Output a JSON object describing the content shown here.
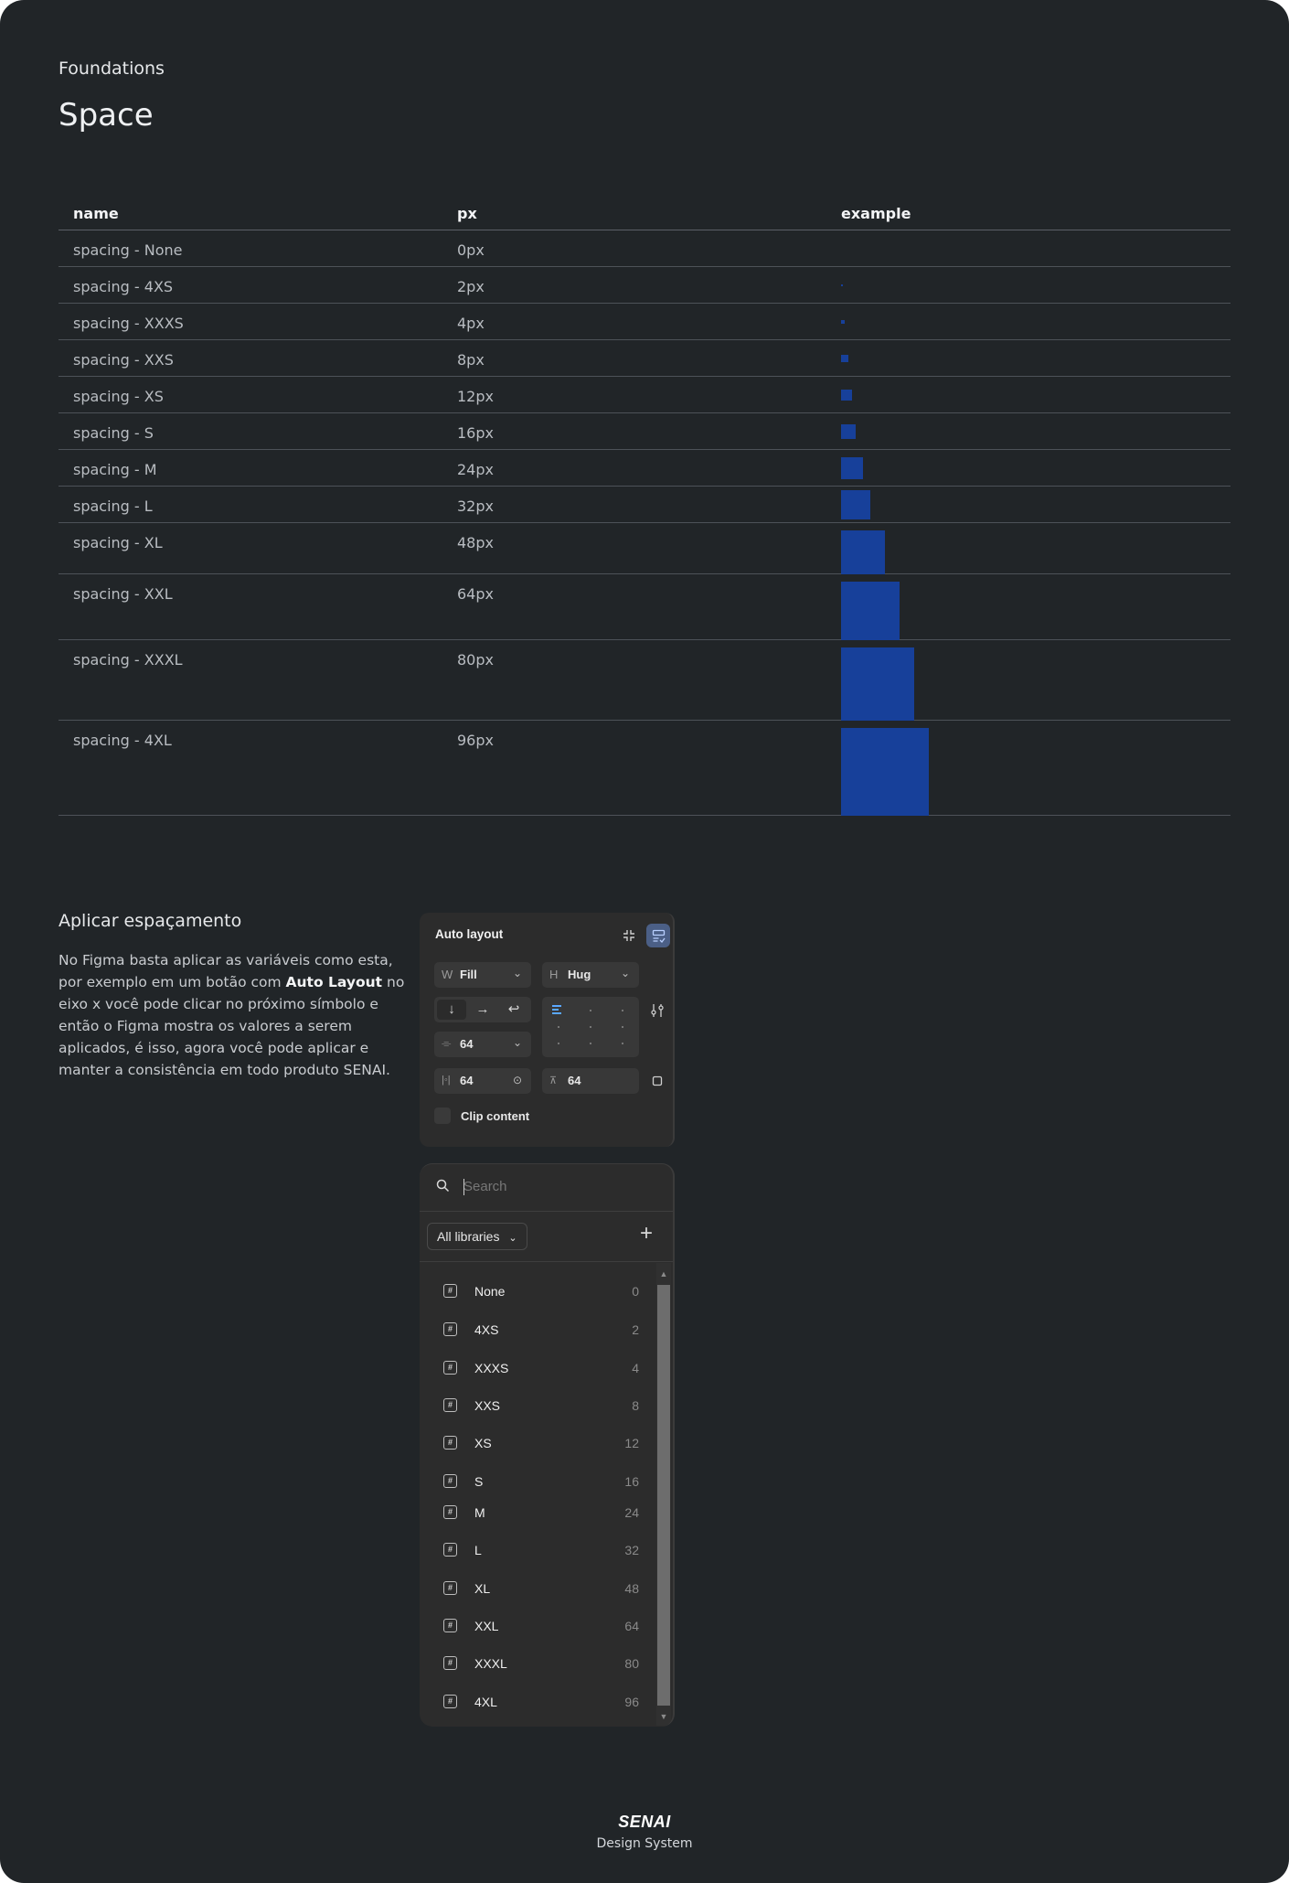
{
  "header": {
    "kicker": "Foundations",
    "title": "Space"
  },
  "table": {
    "columns": [
      "name",
      "px",
      "example"
    ],
    "rows": [
      {
        "name": "spacing - None",
        "px": "0px",
        "size": 0
      },
      {
        "name": "spacing - 4XS",
        "px": "2px",
        "size": 2
      },
      {
        "name": "spacing - XXXS",
        "px": "4px",
        "size": 4
      },
      {
        "name": "spacing - XXS",
        "px": "8px",
        "size": 8
      },
      {
        "name": "spacing - XS",
        "px": "12px",
        "size": 12
      },
      {
        "name": "spacing - S",
        "px": "16px",
        "size": 16
      },
      {
        "name": "spacing - M",
        "px": "24px",
        "size": 24
      },
      {
        "name": "spacing - L",
        "px": "32px",
        "size": 32
      },
      {
        "name": "spacing - XL",
        "px": "48px",
        "size": 48
      },
      {
        "name": "spacing - XXL",
        "px": "64px",
        "size": 64
      },
      {
        "name": "spacing - XXXL",
        "px": "80px",
        "size": 80
      },
      {
        "name": "spacing - 4XL",
        "px": "96px",
        "size": 96
      }
    ],
    "swatch_color": "#17409a"
  },
  "apply": {
    "title": "Aplicar espaçamento",
    "body_before": "No Figma basta aplicar as variáveis como esta, por exemplo em um botão com ",
    "body_bold": "Auto Layout",
    "body_after": " no eixo x você pode clicar no próximo símbolo e então o Figma mostra os valores a serem aplicados, é isso, agora você pode aplicar e manter a consistência em todo produto SENAI."
  },
  "auto_layout_panel": {
    "title": "Auto layout",
    "width_label": "W",
    "width_value": "Fill",
    "height_label": "H",
    "height_value": "Hug",
    "gap_value": "64",
    "padding_h_value": "64",
    "padding_v_value": "64",
    "clip_content_label": "Clip content",
    "icons": [
      "collapse-icon",
      "layout-suggest-icon",
      "arrow-down-icon",
      "arrow-right-icon",
      "wrap-icon",
      "align-left-icon",
      "sliders-icon",
      "gap-icon",
      "padding-h-icon",
      "padding-v-icon",
      "target-icon",
      "resize-icon"
    ]
  },
  "variables_picker": {
    "search_placeholder": "Search",
    "library_filter": "All libraries",
    "items": [
      {
        "name": "None",
        "value": "0"
      },
      {
        "name": "4XS",
        "value": "2"
      },
      {
        "name": "XXXS",
        "value": "4"
      },
      {
        "name": "XXS",
        "value": "8"
      },
      {
        "name": "XS",
        "value": "12"
      },
      {
        "name": "S",
        "value": "16"
      },
      {
        "name": "M",
        "value": "24"
      },
      {
        "name": "L",
        "value": "32"
      },
      {
        "name": "XL",
        "value": "48"
      },
      {
        "name": "XXL",
        "value": "64"
      },
      {
        "name": "XXXL",
        "value": "80"
      },
      {
        "name": "4XL",
        "value": "96"
      }
    ]
  },
  "footer": {
    "logo": "SENAI",
    "subtitle": "Design System"
  }
}
